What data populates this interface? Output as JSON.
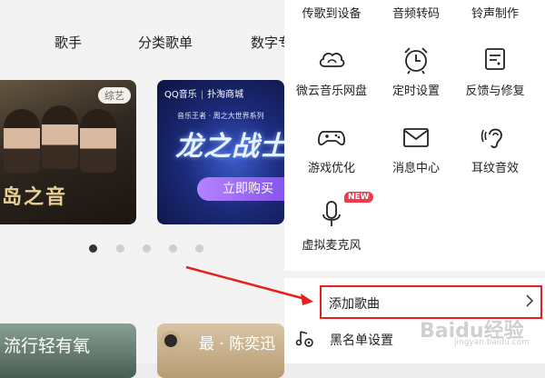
{
  "background": {
    "tabs": [
      "歌手",
      "分类歌单",
      "数字专"
    ],
    "banner_left": {
      "tag": "综艺",
      "title": "岛之音"
    },
    "banner_right": {
      "logo_qq": "QQ音乐",
      "logo_shop": "扑淘商城",
      "subtitle": "音乐王者 · 周之大世界系列",
      "title": "龙之战士",
      "buy_button": "立即购买"
    },
    "carousel": {
      "pages": 5,
      "active_index": 0
    },
    "card_left": "流行轻有氧",
    "card_right": "最 · 陈奕迅"
  },
  "menu": {
    "top_row": [
      "传歌到设备",
      "音频转码",
      "铃声制作"
    ],
    "grid": [
      {
        "label": "微云音乐网盘",
        "icon": "cloud-icon"
      },
      {
        "label": "定时设置",
        "icon": "alarm-clock-icon"
      },
      {
        "label": "反馈与修复",
        "icon": "feedback-icon"
      },
      {
        "label": "游戏优化",
        "icon": "gamepad-icon"
      },
      {
        "label": "消息中心",
        "icon": "mail-icon"
      },
      {
        "label": "耳纹音效",
        "icon": "ear-icon"
      },
      {
        "label": "虚拟麦克风",
        "icon": "microphone-icon",
        "badge": "NEW"
      }
    ],
    "list": [
      {
        "label": "添加歌曲",
        "has_chevron": true
      },
      {
        "label": "黑名单设置",
        "icon": "blacklist-settings-icon"
      }
    ]
  },
  "annotation": {
    "highlight_color": "#e5211d"
  },
  "watermark": {
    "text": "Baidu经验",
    "url": "jingyan.baidu.com"
  }
}
